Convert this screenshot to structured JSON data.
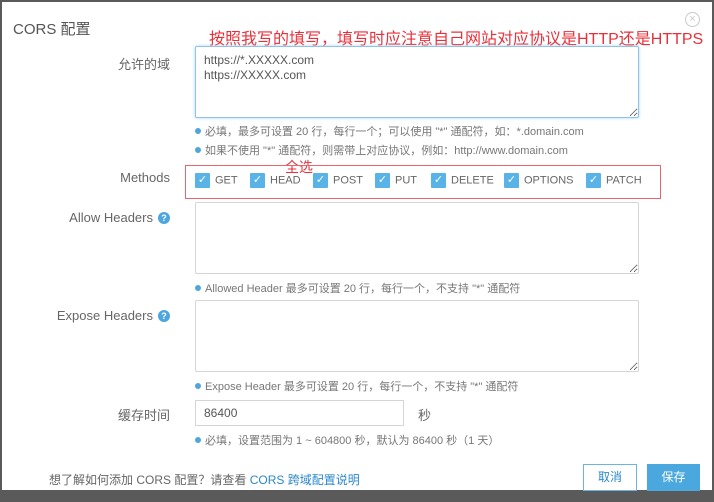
{
  "dialog": {
    "title": "CORS 配置",
    "close_icon": "close-circle-icon"
  },
  "annotations": {
    "top_note": "按照我写的填写，填写时应注意自己网站对应协议是HTTP还是HTTPS",
    "select_all_note": "全选",
    "highlight_color": "#e8303a"
  },
  "form": {
    "allowed_origins": {
      "label": "允许的域",
      "value": "https://*.XXXXX.com\nhttps://XXXXX.com",
      "tips": [
        "必填，最多可设置 20 行，每行一个；可以使用 \"*\" 通配符，如：*.domain.com",
        "如果不使用 \"*\" 通配符，则需带上对应协议，例如：http://www.domain.com"
      ]
    },
    "methods": {
      "label": "Methods",
      "options": [
        {
          "label": "GET",
          "checked": true
        },
        {
          "label": "HEAD",
          "checked": true
        },
        {
          "label": "POST",
          "checked": true
        },
        {
          "label": "PUT",
          "checked": true
        },
        {
          "label": "DELETE",
          "checked": true
        },
        {
          "label": "OPTIONS",
          "checked": true
        },
        {
          "label": "PATCH",
          "checked": true
        }
      ]
    },
    "allow_headers": {
      "label": "Allow Headers",
      "value": "",
      "tip": "Allowed Header 最多可设置 20 行，每行一个，不支持 \"*\" 通配符"
    },
    "expose_headers": {
      "label": "Expose Headers",
      "value": "",
      "tip": "Expose Header 最多可设置 20 行，每行一个，不支持 \"*\" 通配符"
    },
    "cache_time": {
      "label": "缓存时间",
      "value": "86400",
      "unit": "秒",
      "tip": "必填，设置范围为 1 ~ 604800 秒，默认为 86400 秒（1 天）"
    }
  },
  "footer": {
    "text": "想了解如何添加 CORS 配置？请查看 ",
    "link": "CORS 跨域配置说明",
    "cancel_label": "取消",
    "save_label": "保存"
  },
  "colors": {
    "accent": "#4ba8df",
    "link": "#2b88c8"
  }
}
